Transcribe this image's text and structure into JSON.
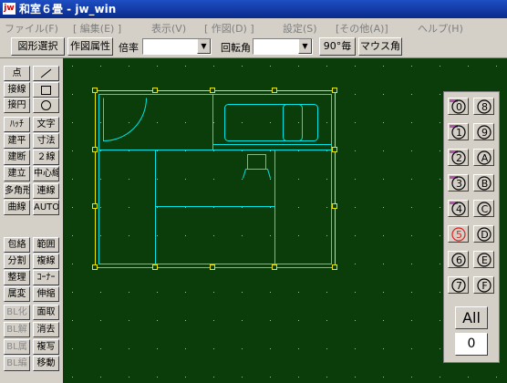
{
  "window": {
    "title": "和室６畳 - jw_win",
    "app_icon_text": "jw"
  },
  "menu": {
    "items": [
      "ファイル(F)",
      "[ 編集(E) ]",
      "表示(V)",
      "[ 作図(D) ]",
      "設定(S)",
      "[その他(A)]",
      "ヘルプ(H)"
    ]
  },
  "toolbar": {
    "select_figure": "図形選択",
    "drawing_attr": "作図属性",
    "scale_label": "倍率",
    "scale_value": "",
    "rotation_label": "回転角",
    "rotation_value": "",
    "deg90": "90°毎",
    "mouse_angle": "マウス角"
  },
  "tools": {
    "col1": [
      "点",
      "接線",
      "接円",
      "ﾊｯﾁ",
      "建平",
      "建断",
      "建立",
      "多角形",
      "曲線",
      "",
      "包絡",
      "分割",
      "整理",
      "属変",
      "BL化",
      "BL解",
      "BL属",
      "BL編"
    ],
    "col2": [
      "",
      "",
      "",
      "文字",
      "寸法",
      "２線",
      "中心線",
      "連線",
      "AUTO",
      "",
      "範囲",
      "複線",
      "ｺｰﾅｰ",
      "伸縮",
      "面取",
      "消去",
      "複写",
      "移動"
    ],
    "col2_icons": [
      "line-tool-icon",
      "rectangle-tool-icon",
      "circle-tool-icon"
    ],
    "disabled_col1": [
      "BL化",
      "BL解",
      "BL属",
      "BL編"
    ]
  },
  "layers": {
    "rows": [
      [
        "0",
        "8"
      ],
      [
        "1",
        "9"
      ],
      [
        "2",
        "A"
      ],
      [
        "3",
        "B"
      ],
      [
        "4",
        "C"
      ],
      [
        "5",
        "D"
      ],
      [
        "6",
        "E"
      ],
      [
        "7",
        "F"
      ]
    ],
    "has_objects": [
      "0",
      "1",
      "2",
      "3",
      "4"
    ],
    "active": "5",
    "all_label": "All",
    "zero_label": "0"
  },
  "colors": {
    "canvas_bg": "#0a3d0a",
    "drawing": "#00e5e5",
    "frame": "#e6e600",
    "layer_mark": "#b84fb8",
    "active_layer": "#e02020"
  }
}
